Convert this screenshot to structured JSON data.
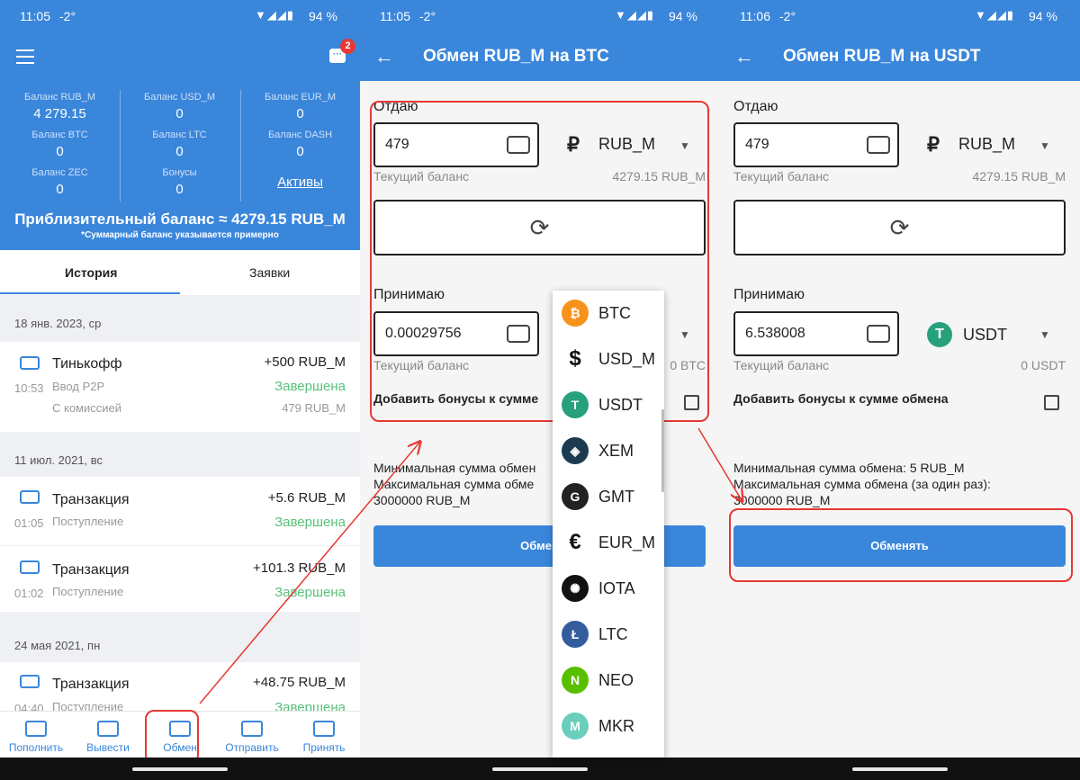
{
  "status": {
    "time1": "11:05",
    "time2": "11:05",
    "time3": "11:06",
    "temp": "-2°",
    "icons": "▼◢◢▮",
    "battery": "94 %"
  },
  "screen1": {
    "badge": "2",
    "balances": [
      {
        "label": "Баланс RUB_M",
        "value": "4 279.15"
      },
      {
        "label": "Баланс USD_M",
        "value": "0"
      },
      {
        "label": "Баланс EUR_M",
        "value": "0"
      },
      {
        "label": "Баланс BTC",
        "value": "0"
      },
      {
        "label": "Баланс LTC",
        "value": "0"
      },
      {
        "label": "Баланс DASH",
        "value": "0"
      },
      {
        "label": "Баланс ZEC",
        "value": "0"
      },
      {
        "label": "Бонусы",
        "value": "0"
      }
    ],
    "assets_link": "Активы",
    "approx": "Приблизительный баланс ≈ 4279.15 RUB_M",
    "approx_note": "*Суммарный баланс указывается примерно",
    "tabs": [
      "История",
      "Заявки"
    ],
    "groups": [
      {
        "date": "18 янв. 2023, ср"
      },
      {
        "date": "11 июл. 2021, вс"
      },
      {
        "date": "24 мая 2021, пн"
      }
    ],
    "tx": [
      {
        "name": "Тинькофф",
        "amount": "+500 RUB_M",
        "time": "10:53",
        "sub": "Ввод P2P",
        "status": "Завершена",
        "extra": "С комиссией",
        "extra_amt": "479 RUB_M"
      },
      {
        "name": "Транзакция",
        "amount": "+5.6 RUB_M",
        "time": "01:05",
        "sub": "Поступление",
        "status": "Завершена"
      },
      {
        "name": "Транзакция",
        "amount": "+101.3 RUB_M",
        "time": "01:02",
        "sub": "Поступление",
        "status": "Завершена"
      },
      {
        "name": "Транзакция",
        "amount": "+48.75 RUB_M",
        "time": "04:40",
        "sub": "Поступление",
        "status": "Завершена"
      }
    ],
    "nav": [
      "Пополнить",
      "Вывести",
      "Обмен",
      "Отправить",
      "Принять"
    ]
  },
  "screen2": {
    "title": "Обмен RUB_M на BTC",
    "give_label": "Отдаю",
    "give_value": "479",
    "give_cur": "RUB_M",
    "give_sym": "₽",
    "balance_label": "Текущий баланс",
    "give_balance": "4279.15 RUB_M",
    "recv_label": "Принимаю",
    "recv_value": "0.00029756",
    "recv_balance": "0 BTC",
    "bonus": "Добавить бонусы к сумме",
    "min": "Минимальная сумма обмен",
    "max": "Максимальная сумма обме",
    "max2": "3000000 RUB_M",
    "button": "Обмен",
    "dropdown": [
      {
        "code": "BTC",
        "icon": "bitcoin-icon",
        "color": "#f7931a",
        "glyph": "₿"
      },
      {
        "code": "USD_M",
        "icon": "dollar-icon",
        "color": "#ffffff",
        "glyph": "$"
      },
      {
        "code": "USDT",
        "icon": "tether-icon",
        "color": "#26a17b",
        "glyph": "T"
      },
      {
        "code": "XEM",
        "icon": "nem-icon",
        "color": "#1d3b50",
        "glyph": "◈"
      },
      {
        "code": "GMT",
        "icon": "gmt-icon",
        "color": "#222222",
        "glyph": "G"
      },
      {
        "code": "EUR_M",
        "icon": "euro-icon",
        "color": "#ffffff",
        "glyph": "€"
      },
      {
        "code": "IOTA",
        "icon": "iota-icon",
        "color": "#111111",
        "glyph": "✺"
      },
      {
        "code": "LTC",
        "icon": "litecoin-icon",
        "color": "#345d9d",
        "glyph": "Ł"
      },
      {
        "code": "NEO",
        "icon": "neo-icon",
        "color": "#58bf00",
        "glyph": "N"
      },
      {
        "code": "MKR",
        "icon": "maker-icon",
        "color": "#6acebb",
        "glyph": "M"
      }
    ]
  },
  "screen3": {
    "title": "Обмен RUB_M на USDT",
    "give_label": "Отдаю",
    "give_value": "479",
    "give_cur": "RUB_M",
    "give_sym": "₽",
    "balance_label": "Текущий баланс",
    "give_balance": "4279.15 RUB_M",
    "recv_label": "Принимаю",
    "recv_value": "6.538008",
    "recv_cur": "USDT",
    "recv_balance": "0 USDT",
    "bonus": "Добавить бонусы к сумме обмена",
    "min": "Минимальная сумма обмена: 5 RUB_M",
    "max": "Максимальная сумма обмена (за один раз):",
    "max2": "3000000 RUB_M",
    "button": "Обменять"
  },
  "colors": {
    "primary": "#3a86db",
    "success": "#57c17a",
    "annotation": "#e53935"
  }
}
